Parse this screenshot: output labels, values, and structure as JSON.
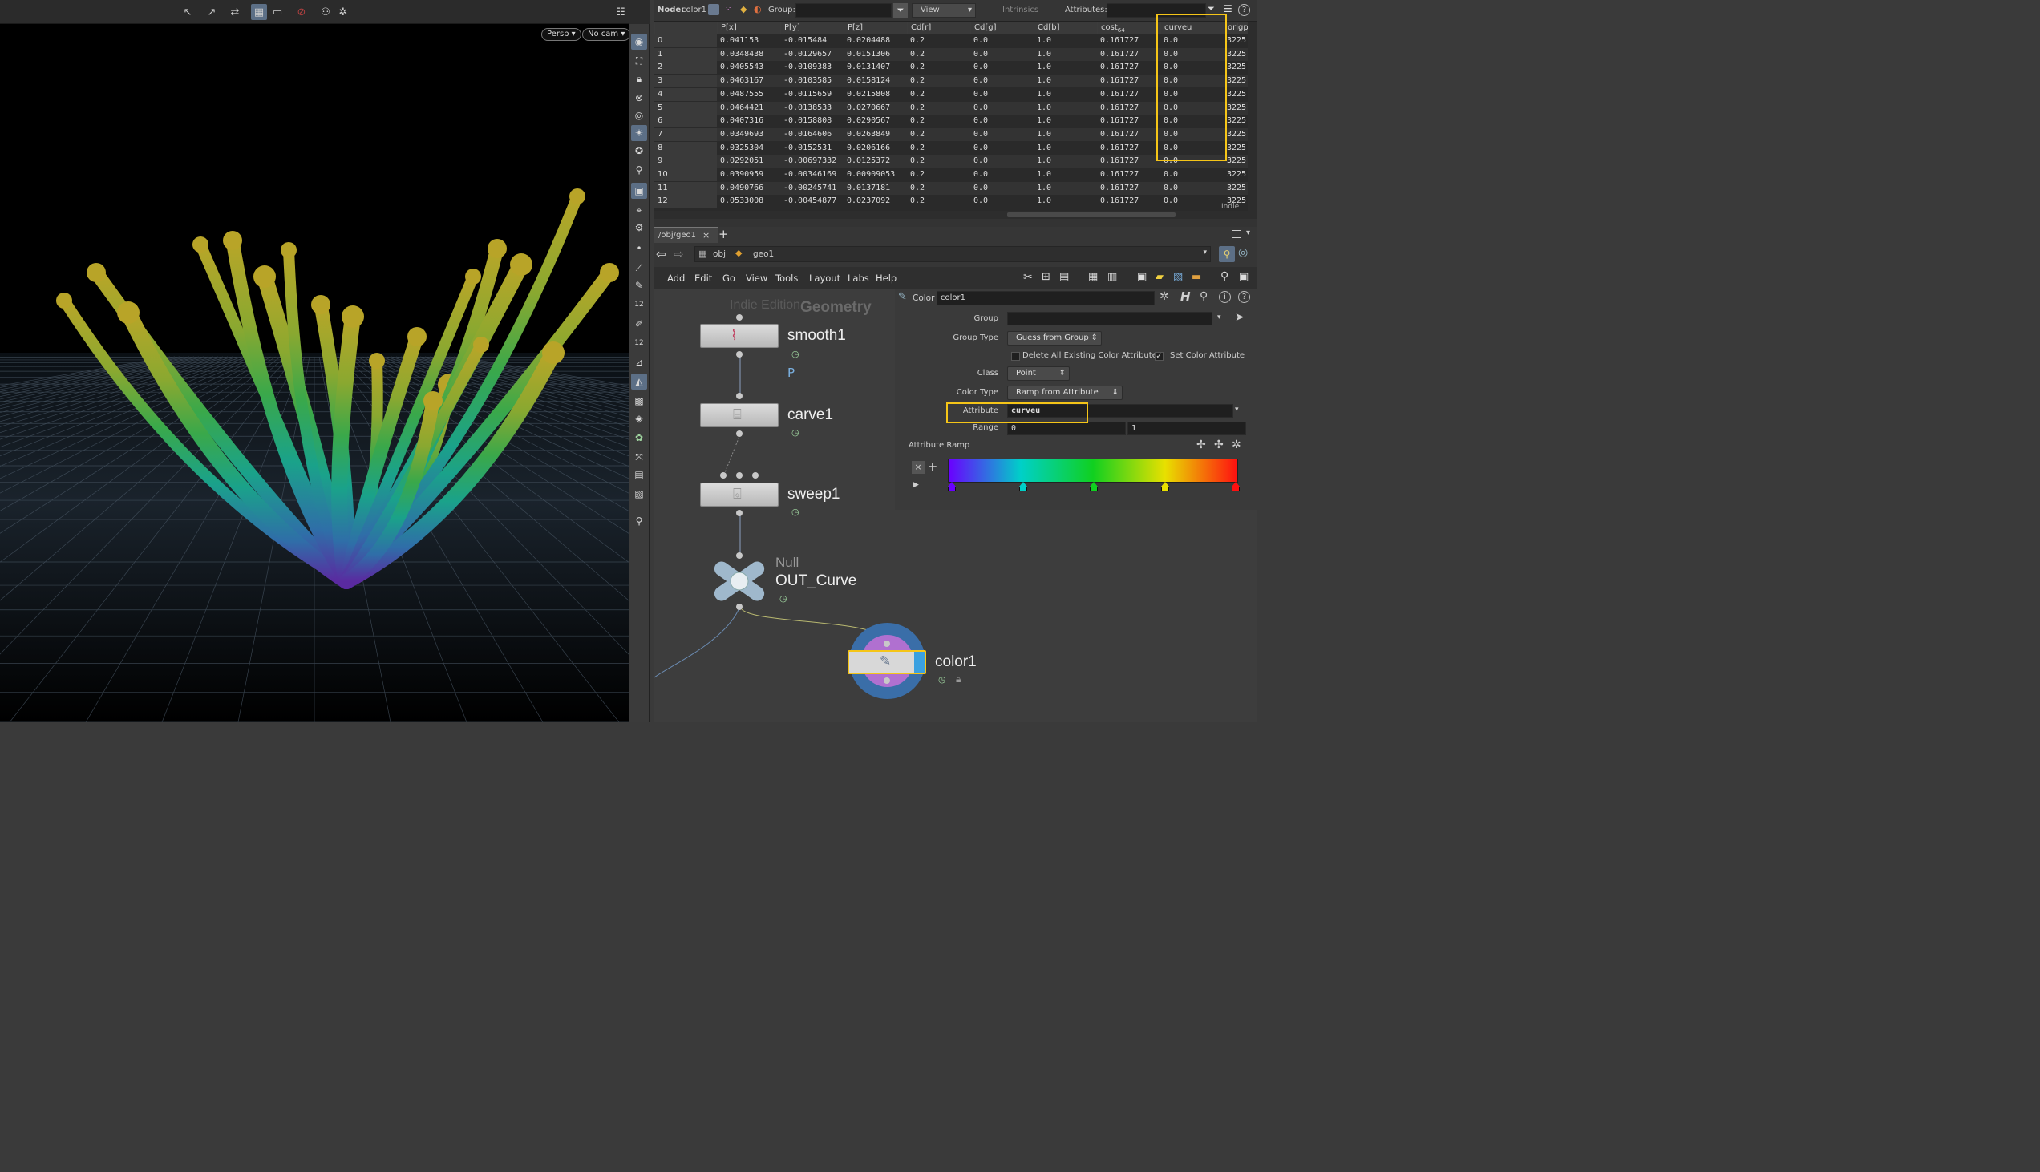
{
  "viewport": {
    "persp_label": "Persp",
    "cam_label": "No cam"
  },
  "spreadsheet": {
    "node_label": "Node:",
    "node_value": "color1",
    "group_label": "Group:",
    "view_label": "View",
    "intrinsics_label": "Intrinsics",
    "attributes_label": "Attributes:",
    "corner_label": "Indie",
    "columns": [
      "",
      "P[x]",
      "P[y]",
      "P[z]",
      "Cd[r]",
      "Cd[g]",
      "Cd[b]",
      "cost",
      "curveu",
      "origp"
    ],
    "cost_subscript": "64",
    "rows": [
      [
        "0",
        "0.041153",
        "-0.015484",
        "0.0204488",
        "0.2",
        "0.0",
        "1.0",
        "0.161727",
        "0.0",
        "3225"
      ],
      [
        "1",
        "0.0348438",
        "-0.0129657",
        "0.0151306",
        "0.2",
        "0.0",
        "1.0",
        "0.161727",
        "0.0",
        "3225"
      ],
      [
        "2",
        "0.0405543",
        "-0.0109383",
        "0.0131407",
        "0.2",
        "0.0",
        "1.0",
        "0.161727",
        "0.0",
        "3225"
      ],
      [
        "3",
        "0.0463167",
        "-0.0103585",
        "0.0158124",
        "0.2",
        "0.0",
        "1.0",
        "0.161727",
        "0.0",
        "3225"
      ],
      [
        "4",
        "0.0487555",
        "-0.0115659",
        "0.0215808",
        "0.2",
        "0.0",
        "1.0",
        "0.161727",
        "0.0",
        "3225"
      ],
      [
        "5",
        "0.0464421",
        "-0.0138533",
        "0.0270667",
        "0.2",
        "0.0",
        "1.0",
        "0.161727",
        "0.0",
        "3225"
      ],
      [
        "6",
        "0.0407316",
        "-0.0158808",
        "0.0290567",
        "0.2",
        "0.0",
        "1.0",
        "0.161727",
        "0.0",
        "3225"
      ],
      [
        "7",
        "0.0349693",
        "-0.0164606",
        "0.0263849",
        "0.2",
        "0.0",
        "1.0",
        "0.161727",
        "0.0",
        "3225"
      ],
      [
        "8",
        "0.0325304",
        "-0.0152531",
        "0.0206166",
        "0.2",
        "0.0",
        "1.0",
        "0.161727",
        "0.0",
        "3225"
      ],
      [
        "9",
        "0.0292051",
        "-0.00697332",
        "0.0125372",
        "0.2",
        "0.0",
        "1.0",
        "0.161727",
        "0.0",
        "3225"
      ],
      [
        "10",
        "0.0390959",
        "-0.00346169",
        "0.00909053",
        "0.2",
        "0.0",
        "1.0",
        "0.161727",
        "0.0",
        "3225"
      ],
      [
        "11",
        "0.0490766",
        "-0.00245741",
        "0.0137181",
        "0.2",
        "0.0",
        "1.0",
        "0.161727",
        "0.0",
        "3225"
      ],
      [
        "12",
        "0.0533008",
        "-0.00454877",
        "0.0237092",
        "0.2",
        "0.0",
        "1.0",
        "0.161727",
        "0.0",
        "3225"
      ]
    ]
  },
  "network": {
    "tab_label": "/obj/geo1",
    "path_obj": "obj",
    "path_geo": "geo1",
    "menu": [
      "Add",
      "Edit",
      "Go",
      "View",
      "Tools",
      "Layout",
      "Labs",
      "Help"
    ],
    "watermark_edition": "Indie Edition",
    "watermark_context": "Geometry",
    "nodes": {
      "smooth": "smooth1",
      "smooth_flag": "P",
      "carve": "carve1",
      "sweep": "sweep1",
      "null_type": "Null",
      "null_name": "OUT_Curve",
      "color": "color1"
    }
  },
  "params": {
    "type_label": "Color",
    "node_name": "color1",
    "group_label": "Group",
    "group_value": "",
    "group_type_label": "Group Type",
    "group_type_value": "Guess from Group",
    "delete_label": "Delete All Existing Color Attributes",
    "set_color_label": "Set Color Attribute",
    "class_label": "Class",
    "class_value": "Point",
    "color_type_label": "Color Type",
    "color_type_value": "Ramp from Attribute",
    "attribute_label": "Attribute",
    "attribute_value": "curveu",
    "range_label": "Range",
    "range_min": "0",
    "range_max": "1",
    "ramp_label": "Attribute Ramp",
    "ramp_colors": [
      "#6a00ff",
      "#00d0c8",
      "#10d020",
      "#e8e000",
      "#ff1010"
    ]
  },
  "colors": {
    "highlight": "#f5c518",
    "selected_tool": "#5c6f86"
  }
}
